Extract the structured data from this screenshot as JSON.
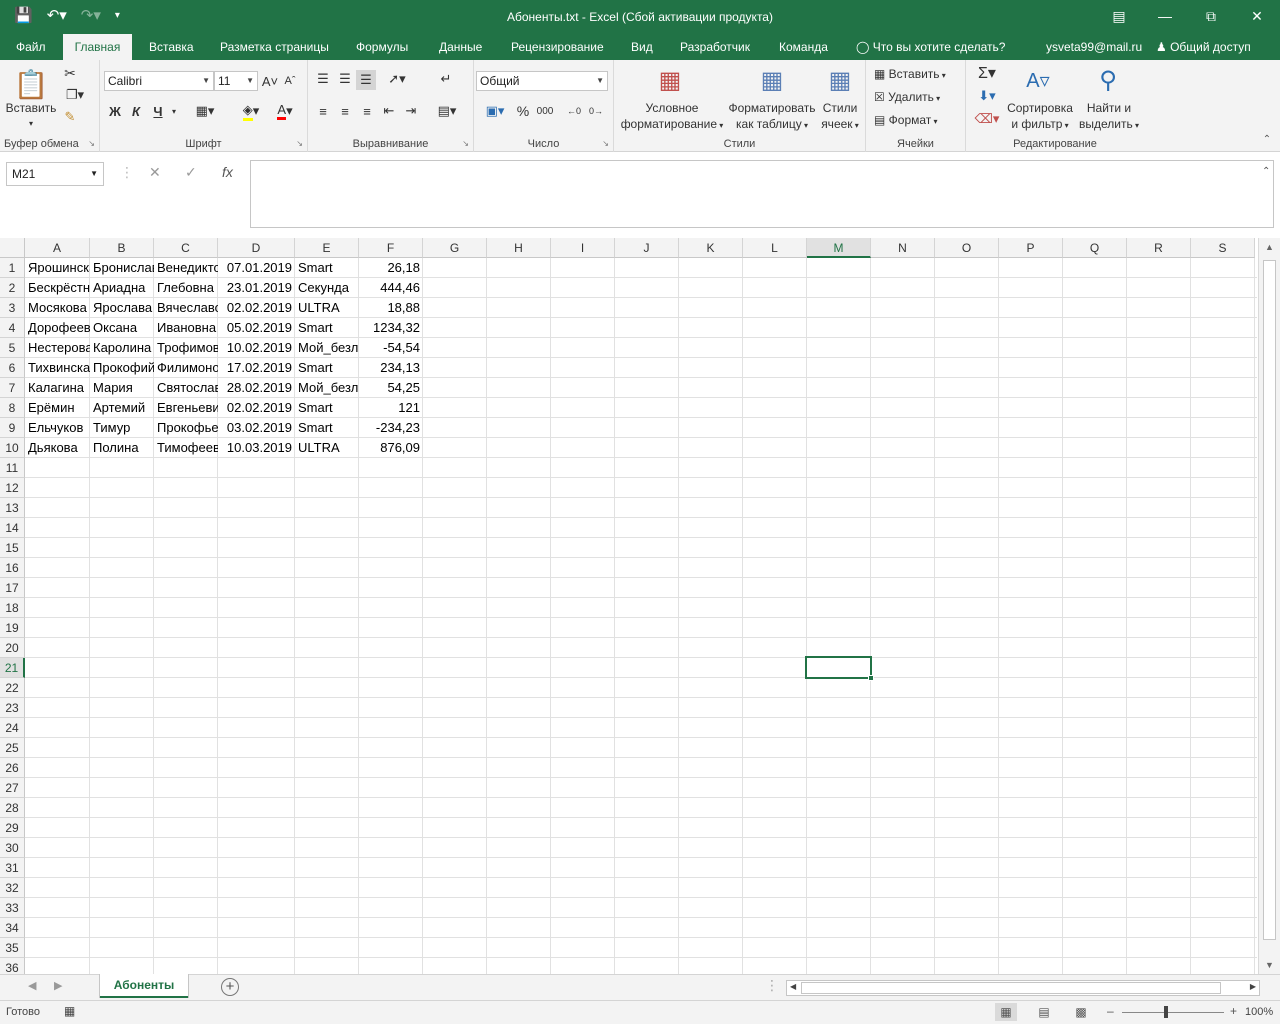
{
  "window": {
    "title": "Абоненты.txt - Excel (Сбой активации продукта)",
    "qat_icons": [
      "save-icon",
      "undo-icon",
      "redo-icon",
      "customize-qat-icon"
    ],
    "controls": [
      "ribbon-display-icon",
      "minimize-icon",
      "restore-icon",
      "close-icon"
    ]
  },
  "tabs": [
    "Файл",
    "Главная",
    "Вставка",
    "Разметка страницы",
    "Формулы",
    "Данные",
    "Рецензирование",
    "Вид",
    "Разработчик",
    "Команда"
  ],
  "active_tab": "Главная",
  "tell_me": "Что вы хотите сделать?",
  "user": "ysveta99@mail.ru",
  "share": "Общий доступ",
  "ribbon": {
    "clipboard": {
      "label": "Буфер обмена",
      "paste": "Вставить"
    },
    "font": {
      "label": "Шрифт",
      "name": "Calibri",
      "size": "11",
      "bold": "Ж",
      "italic": "К",
      "underline": "Ч"
    },
    "alignment": {
      "label": "Выравнивание"
    },
    "number": {
      "label": "Число",
      "format": "Общий"
    },
    "styles": {
      "label": "Стили",
      "conditional_1": "Условное",
      "conditional_2": "форматирование",
      "table_1": "Форматировать",
      "table_2": "как таблицу",
      "cell_1": "Стили",
      "cell_2": "ячеек"
    },
    "cells": {
      "label": "Ячейки",
      "insert": "Вставить",
      "delete": "Удалить",
      "format": "Формат"
    },
    "editing": {
      "label": "Редактирование",
      "sort_1": "Сортировка",
      "sort_2": "и фильтр",
      "find_1": "Найти и",
      "find_2": "выделить"
    }
  },
  "name_box": "M21",
  "formula": "",
  "columns": [
    "A",
    "B",
    "C",
    "D",
    "E",
    "F",
    "G",
    "H",
    "I",
    "J",
    "K",
    "L",
    "M",
    "N",
    "O",
    "P",
    "Q",
    "R",
    "S"
  ],
  "selected_column": "M",
  "selected_row": 21,
  "rows": [
    [
      "Ярошинска",
      "Бронислава",
      "Венедиктовна",
      "07.01.2019",
      "Smart",
      "26,18"
    ],
    [
      "Бескрёстных",
      "Ариадна",
      "Глебовна",
      "23.01.2019",
      "Секунда",
      "444,46"
    ],
    [
      "Мосякова",
      "Ярослава",
      "Вячеславовна",
      "02.02.2019",
      "ULTRA",
      "18,88"
    ],
    [
      "Дорофеева",
      "Оксана",
      "Ивановна",
      "05.02.2019",
      "Smart",
      "1234,32"
    ],
    [
      "Нестерова",
      "Каролина",
      "Трофимовна",
      "10.02.2019",
      "Мой_безлимит",
      "-54,54"
    ],
    [
      "Тихвинская",
      "Прокофий",
      "Филимонович",
      "17.02.2019",
      "Smart",
      "234,13"
    ],
    [
      "Калагина",
      "Мария",
      "Святославовна",
      "28.02.2019",
      "Мой_безлимит",
      "54,25"
    ],
    [
      "Ерёмин",
      "Артемий",
      "Евгеньевич",
      "02.02.2019",
      "Smart",
      "121"
    ],
    [
      "Ельчуков",
      "Тимур",
      "Прокофьевич",
      "03.02.2019",
      "Smart",
      "-234,23"
    ],
    [
      "Дьякова",
      "Полина",
      "Тимофеевна",
      "10.03.2019",
      "ULTRA",
      "876,09"
    ]
  ],
  "sheet_tab": "Абоненты",
  "status": "Готово",
  "zoom": "100%"
}
